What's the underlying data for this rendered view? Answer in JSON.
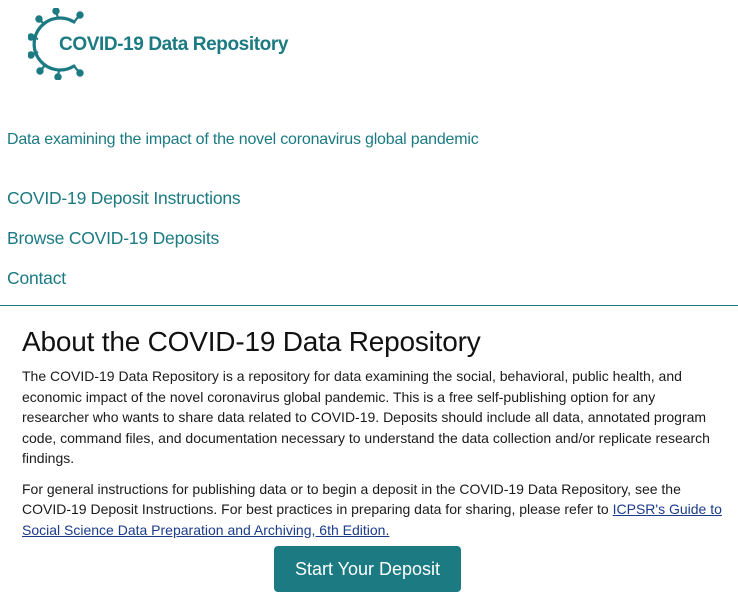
{
  "logo": {
    "text": "COVID-19 Data Repository",
    "icon": "virus-ring-icon",
    "color": "#1b7a82"
  },
  "tagline": "Data examining the impact of the novel coronavirus global pandemic",
  "nav": {
    "items": [
      {
        "label": "COVID-19 Deposit Instructions"
      },
      {
        "label": "Browse COVID-19 Deposits"
      },
      {
        "label": "Contact"
      }
    ]
  },
  "about": {
    "heading": "About the COVID-19 Data Repository",
    "paragraph1": "The COVID-19 Data Repository is a repository for data examining the social, behavioral, public health, and economic impact of the novel coronavirus global pandemic. This is a free self-publishing option for any researcher who wants to share data related to COVID-19. Deposits should include all data, annotated program code, command files, and documentation necessary to understand the data collection and/or replicate research findings.",
    "paragraph2_text": "For general instructions for publishing data or to begin a deposit in the COVID-19 Data Repository, see the COVID-19 Deposit Instructions. For best practices in preparing data for sharing, please refer to ",
    "paragraph2_link": "ICPSR's Guide to Social Science Data Preparation and Archiving, 6th Edition."
  },
  "cta": {
    "label": "Start Your Deposit"
  },
  "colors": {
    "accent": "#1b7a82",
    "link": "#1a3a8a"
  }
}
